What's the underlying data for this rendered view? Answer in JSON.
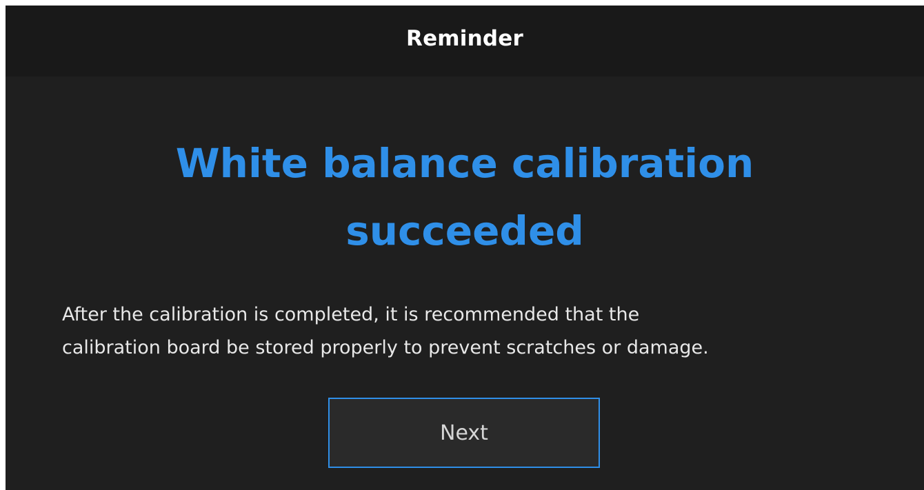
{
  "dialog": {
    "title": "Reminder",
    "headline_line1": "White balance calibration",
    "headline_line2": "succeeded",
    "message_line1": "After the calibration is completed, it is recommended that the",
    "message_line2": "calibration board be stored properly to prevent scratches or damage.",
    "next_label": "Next"
  },
  "colors": {
    "background": "#1f1f1f",
    "titlebar": "#191919",
    "accent": "#2f8fe8",
    "text": "#e8e8e8"
  }
}
